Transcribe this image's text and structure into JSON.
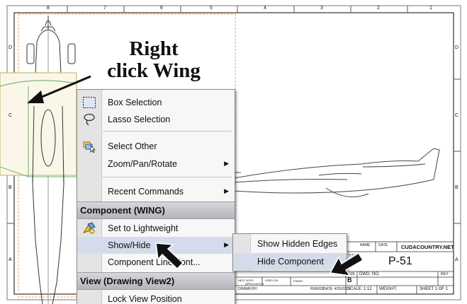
{
  "callout": {
    "line1": "Right",
    "line2": "click Wing"
  },
  "border": {
    "top_numbers": [
      "8",
      "7",
      "6",
      "5",
      "4",
      "3",
      "2",
      "1"
    ],
    "side_letters": [
      "D",
      "C",
      "B",
      "A"
    ]
  },
  "context_menu": {
    "items_top": [
      {
        "label": "Box Selection",
        "icon": "box-selection-icon"
      },
      {
        "label": "Lasso Selection",
        "icon": "lasso-selection-icon"
      },
      {
        "label": "Select Other",
        "icon": "select-other-icon"
      },
      {
        "label": "Zoom/Pan/Rotate",
        "submenu": true
      },
      {
        "label": "Recent Commands",
        "submenu": true
      }
    ],
    "section_component": "Component (WING)",
    "items_component": [
      {
        "label": "Set to Lightweight",
        "icon": "lightweight-icon"
      },
      {
        "label": "Show/Hide",
        "submenu": true
      },
      {
        "label": "Component Line Font..."
      }
    ],
    "section_view": "View (Drawing View2)",
    "items_view": [
      {
        "label": "Lock View Position"
      }
    ]
  },
  "submenu": {
    "items": [
      "Show Hidden Edges",
      "Hide Component"
    ]
  },
  "title_block": {
    "company": "CUDACOUNTRY.NET",
    "title_label": "TITLE:",
    "title": "P-51",
    "size_label": "SIZE",
    "size": "B",
    "dwg_no_label": "DWG. NO.",
    "rev_label": "REV",
    "scale": "SCALE: 1:12",
    "weight": "WEIGHT:",
    "sheet": "SHEET 1 OF 1",
    "name_label": "NAME",
    "date_label": "DATE",
    "drawn_by": "DRAWN BY:",
    "period": "PERIOD:",
    "date_value": "DATE: 4/20/2013",
    "next_assy": "NEXT ASSY",
    "used_on": "USED ON",
    "finish": "FINISH",
    "application": "APPLICATION"
  },
  "colors": {
    "selection": "#d4dceb",
    "highlight_outline": "#c9b97a",
    "wing_edge": "#6bb36b"
  }
}
